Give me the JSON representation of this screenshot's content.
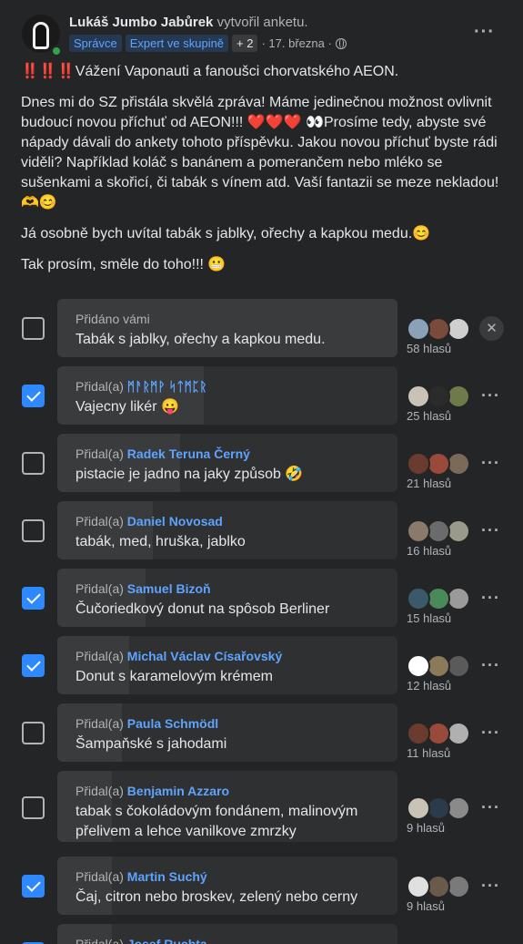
{
  "post": {
    "author": "Lukáš Jumbo Jabůrek",
    "action": "vytvořil anketu.",
    "badges": [
      "Správce",
      "Expert ve skupině",
      "+ 2"
    ],
    "date": "· 17. března ·",
    "paragraphs": [
      "‼️‼️‼️Vážení Vaponauti a fanoušci chorvatského AEON.",
      "Dnes mi do SZ přistála skvělá zpráva! Máme jedinečnou možnost ovlivnit budoucí novou příchuť od AEON!!! ❤️❤️❤️ 👀Prosíme tedy, abyste své nápady dávali do ankety tohoto příspěvku. Jakou novou příchuť byste rádi viděli? Například koláč s banánem a pomerančem nebo mléko se sušenkami a skořicí, či tabák s vínem atd. Vaší fantazii se meze nekladou!🫶😊",
      "Já osobně bych uvítal tabák s jablky, ořechy a kapkou medu.😊",
      "Tak prosím, směle do toho!!! 😬"
    ]
  },
  "poll": {
    "options": [
      {
        "prefix": "Přidáno vámi",
        "by": "",
        "text": "Tabák s jablky, ořechy a kapkou medu.",
        "votes": "58 hlasů",
        "vote_fraction": 1.0,
        "checked": false,
        "own": true,
        "avatars": [
          "#8aa2b8",
          "#7a4a3a",
          "#cfcfcf"
        ]
      },
      {
        "prefix": "Přidal(a)",
        "by": "ᛗᚨᚱᛗᚹ ᛋᛏᛗᛈᚱ",
        "text": "Vajecny likér 😛",
        "votes": "25 hlasů",
        "vote_fraction": 0.43,
        "checked": true,
        "own": false,
        "avatars": [
          "#c9c2b6",
          "#2b2b2b",
          "#6e7a4a"
        ]
      },
      {
        "prefix": "Přidal(a)",
        "by": "Radek Teruna Černý",
        "text": "pistacie je jadno na jaky způsob 🤣",
        "votes": "21 hlasů",
        "vote_fraction": 0.36,
        "checked": false,
        "own": false,
        "avatars": [
          "#6a3b2e",
          "#9a4a3a",
          "#7b6a5a"
        ]
      },
      {
        "prefix": "Přidal(a)",
        "by": "Daniel Novosad",
        "text": "tabák, med, hruška, jablko",
        "votes": "16 hlasů",
        "vote_fraction": 0.28,
        "checked": false,
        "own": false,
        "avatars": [
          "#8a7a6a",
          "#6b6b6b",
          "#9a9a8a"
        ]
      },
      {
        "prefix": "Přidal(a)",
        "by": "Samuel Bizoň",
        "text": "Čučoriedkový donut na spôsob Berliner",
        "votes": "15 hlasů",
        "vote_fraction": 0.26,
        "checked": true,
        "own": false,
        "avatars": [
          "#3a5a6a",
          "#4a8a5a",
          "#9a9a9a"
        ]
      },
      {
        "prefix": "Přidal(a)",
        "by": "Michal Václav Císařovský",
        "text": "Donut s karamelovým krémem",
        "votes": "12 hlasů",
        "vote_fraction": 0.21,
        "checked": true,
        "own": false,
        "avatars": [
          "#ffffff",
          "#8a7a5a",
          "#5a5a5a"
        ]
      },
      {
        "prefix": "Přidal(a)",
        "by": "Paula Schmödl",
        "text": "Šampaňské s jahodami",
        "votes": "11 hlasů",
        "vote_fraction": 0.19,
        "checked": false,
        "own": false,
        "avatars": [
          "#6a3b2e",
          "#9a4a3a",
          "#b0b0b0"
        ]
      },
      {
        "prefix": "Přidal(a)",
        "by": "Benjamin Azzaro",
        "text": "tabak s čokoládovým fondánem, malinovým přelivem a lehce vanilkove zmrzky",
        "votes": "9 hlasů",
        "vote_fraction": 0.16,
        "checked": false,
        "own": false,
        "avatars": [
          "#c9c2b6",
          "#2b3b4b",
          "#8a8a8a"
        ]
      },
      {
        "prefix": "Přidal(a)",
        "by": "Martin Suchý",
        "text": "Čaj, citron nebo broskev, zelený nebo cerny",
        "votes": "9 hlasů",
        "vote_fraction": 0.16,
        "checked": true,
        "own": false,
        "avatars": [
          "#e0e0e0",
          "#6a5a4a",
          "#7a7a7a"
        ]
      },
      {
        "prefix": "Přidal(a)",
        "by": "Josef Ruchta",
        "text": "",
        "votes": "",
        "vote_fraction": 0.16,
        "checked": true,
        "own": false,
        "avatars": [
          "#8a8a8a",
          "#5a5a5a",
          "#9a9a9a"
        ]
      }
    ]
  },
  "colors": {
    "accent": "#2e89ff",
    "link": "#5ea4ff",
    "background": "#242526"
  }
}
